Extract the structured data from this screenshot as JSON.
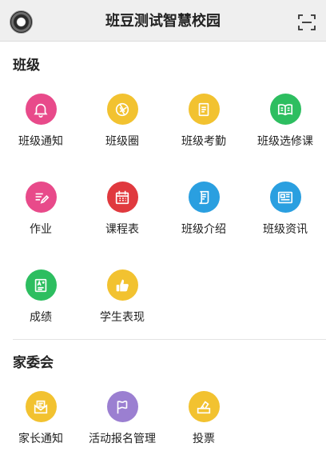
{
  "header": {
    "title": "班豆测试智慧校园"
  },
  "sections": {
    "class": {
      "title": "班级",
      "items": [
        {
          "label": "班级通知",
          "icon": "bell-icon",
          "color": "#E84A8A"
        },
        {
          "label": "班级圈",
          "icon": "aperture-icon",
          "color": "#F2C230"
        },
        {
          "label": "班级考勤",
          "icon": "clipboard-icon",
          "color": "#F2C230"
        },
        {
          "label": "班级选修课",
          "icon": "book-icon",
          "color": "#2DBE60"
        },
        {
          "label": "作业",
          "icon": "homework-icon",
          "color": "#E84A8A"
        },
        {
          "label": "课程表",
          "icon": "calendar-icon",
          "color": "#E0393E"
        },
        {
          "label": "班级介绍",
          "icon": "scroll-icon",
          "color": "#2A9FE0"
        },
        {
          "label": "班级资讯",
          "icon": "news-icon",
          "color": "#2A9FE0"
        },
        {
          "label": "成绩",
          "icon": "grade-icon",
          "color": "#2DBE60"
        },
        {
          "label": "学生表现",
          "icon": "thumbs-up-icon",
          "color": "#F2C230"
        }
      ]
    },
    "parents": {
      "title": "家委会",
      "items": [
        {
          "label": "家长通知",
          "icon": "mail-icon",
          "color": "#F2C230"
        },
        {
          "label": "活动报名管理",
          "icon": "flag-icon",
          "color": "#9B7FD1"
        },
        {
          "label": "投票",
          "icon": "ballot-icon",
          "color": "#F2C230"
        }
      ]
    }
  }
}
